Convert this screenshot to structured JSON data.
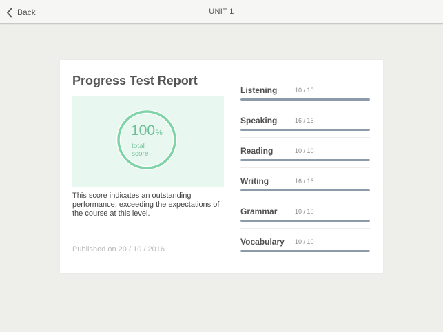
{
  "header": {
    "back_label": "Back",
    "title": "UNIT 1"
  },
  "report": {
    "heading": "Progress Test Report",
    "score": {
      "value": "100",
      "unit": "%",
      "caption_line1": "total",
      "caption_line2": "score"
    },
    "description": "This score indicates an outstanding performance, exceeding the expectations of the course at this level.",
    "published": "Published on 20 / 10 / 2016"
  },
  "skills": [
    {
      "name": "Listening",
      "score": "10 / 10",
      "fraction": 1.0
    },
    {
      "name": "Speaking",
      "score": "16 / 16",
      "fraction": 1.0
    },
    {
      "name": "Reading",
      "score": "10 / 10",
      "fraction": 1.0
    },
    {
      "name": "Writing",
      "score": "16 / 16",
      "fraction": 1.0
    },
    {
      "name": "Grammar",
      "score": "10 / 10",
      "fraction": 1.0
    },
    {
      "name": "Vocabulary",
      "score": "10 / 10",
      "fraction": 1.0
    }
  ],
  "colors": {
    "score_ring": "#7fd3a6",
    "score_panel": "#e8f7ef",
    "progress_fill": "#8d9aaa"
  },
  "icons": {
    "back": "chevron-left-icon"
  }
}
